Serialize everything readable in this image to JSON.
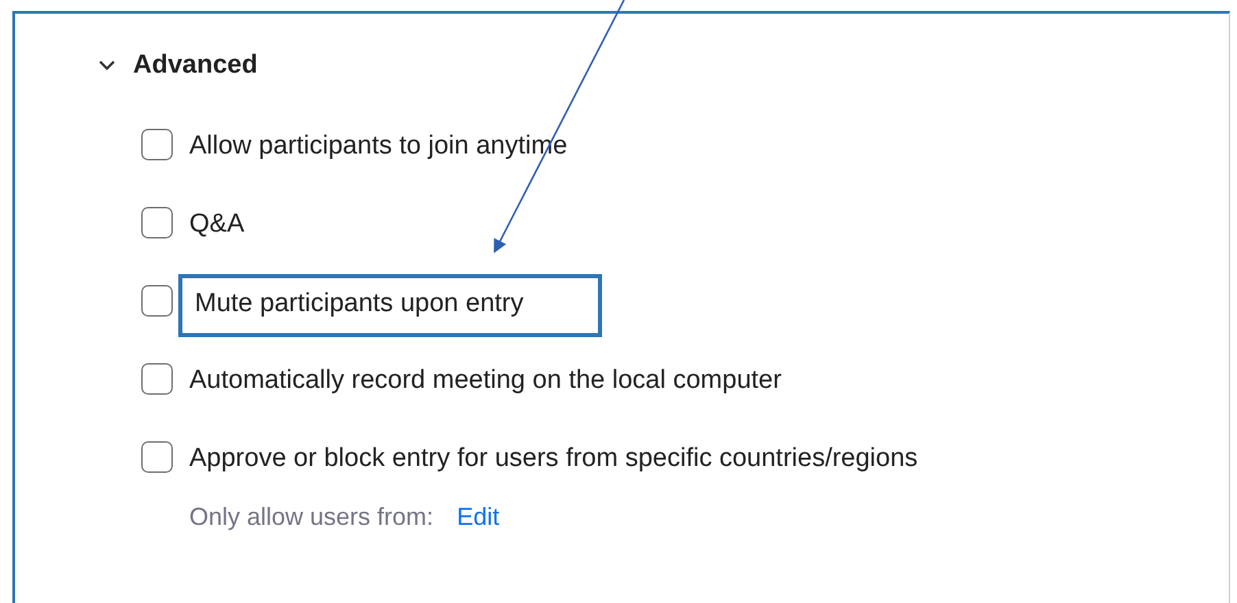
{
  "section": {
    "title": "Advanced",
    "expanded": true
  },
  "options": [
    {
      "label": "Allow participants to join anytime",
      "checked": false,
      "highlighted": false
    },
    {
      "label": "Q&A",
      "checked": false,
      "highlighted": false
    },
    {
      "label": "Mute participants upon entry",
      "checked": false,
      "highlighted": true
    },
    {
      "label": "Automatically record meeting on the local computer",
      "checked": false,
      "highlighted": false
    },
    {
      "label": "Approve or block entry for users from specific countries/regions",
      "checked": false,
      "highlighted": false,
      "note": "Only allow users from:",
      "link": "Edit"
    }
  ]
}
